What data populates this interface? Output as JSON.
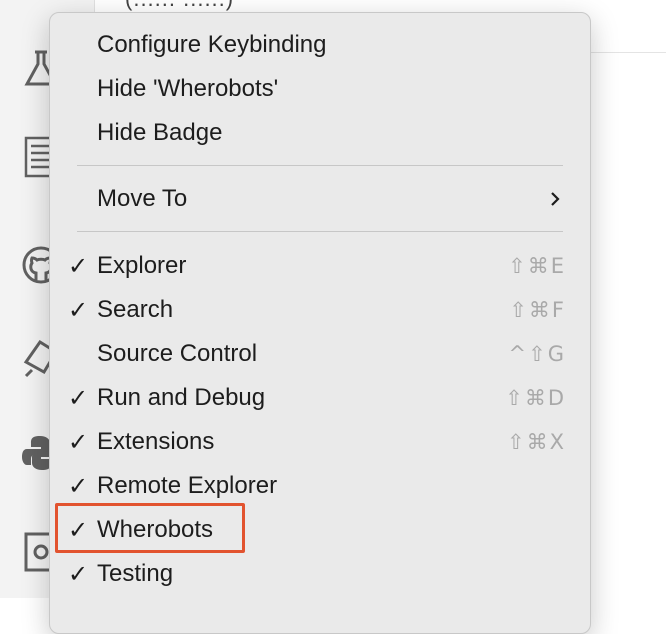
{
  "background_title": "(...... ......)",
  "activity_icons": [
    "flask-icon",
    "document-icon",
    "github-icon",
    "remote-icon",
    "python-icon",
    "preview-icon"
  ],
  "menu": {
    "items": [
      {
        "label": "Configure Keybinding"
      },
      {
        "label": "Hide 'Wherobots'"
      },
      {
        "label": "Hide Badge"
      },
      {
        "label": "Move To"
      },
      {
        "label": "Explorer",
        "check": "✓",
        "shortcut": "⇧⌘E"
      },
      {
        "label": "Search",
        "check": "✓",
        "shortcut": "⇧⌘F"
      },
      {
        "label": "Source Control",
        "check": "",
        "shortcut": "^⇧G"
      },
      {
        "label": "Run and Debug",
        "check": "✓",
        "shortcut": "⇧⌘D"
      },
      {
        "label": "Extensions",
        "check": "✓",
        "shortcut": "⇧⌘X"
      },
      {
        "label": "Remote Explorer",
        "check": "✓"
      },
      {
        "label": "Wherobots",
        "check": "✓"
      },
      {
        "label": "Testing",
        "check": "✓"
      }
    ]
  },
  "colors": {
    "menu_background": "#eaeaea",
    "highlight_border": "#e2532f",
    "shortcut_text": "#a9a9a9"
  }
}
